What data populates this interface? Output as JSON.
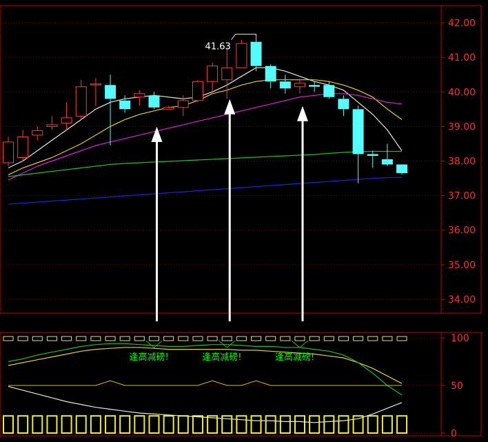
{
  "chart_data": [
    {
      "type": "candlestick",
      "ylim": [
        33.6,
        42.5
      ],
      "y_ticks": [
        "42.00",
        "41.00",
        "40.00",
        "39.00",
        "38.00",
        "37.00",
        "36.00",
        "35.00",
        "34.00"
      ],
      "peak_label": "41.63",
      "candles": [
        {
          "o": 37.95,
          "c": 38.55,
          "h": 38.7,
          "l": 37.85
        },
        {
          "o": 38.1,
          "c": 38.7,
          "h": 38.9,
          "l": 38.0
        },
        {
          "o": 38.75,
          "c": 38.88,
          "h": 39.0,
          "l": 38.6
        },
        {
          "o": 39.0,
          "c": 39.05,
          "h": 39.3,
          "l": 38.9
        },
        {
          "o": 39.1,
          "c": 39.25,
          "h": 39.7,
          "l": 38.9
        },
        {
          "o": 39.3,
          "c": 40.15,
          "h": 40.35,
          "l": 39.2
        },
        {
          "o": 40.2,
          "c": 40.23,
          "h": 40.4,
          "l": 39.6
        },
        {
          "o": 40.2,
          "c": 39.8,
          "h": 40.5,
          "l": 38.45
        },
        {
          "o": 39.75,
          "c": 39.5,
          "h": 39.9,
          "l": 39.4
        },
        {
          "o": 39.85,
          "c": 39.95,
          "h": 40.05,
          "l": 39.6
        },
        {
          "o": 39.9,
          "c": 39.55,
          "h": 40.0,
          "l": 39.5
        },
        {
          "o": 39.5,
          "c": 39.55,
          "h": 39.6,
          "l": 39.5
        },
        {
          "o": 39.55,
          "c": 39.75,
          "h": 39.9,
          "l": 39.3
        },
        {
          "o": 39.75,
          "c": 40.3,
          "h": 40.35,
          "l": 39.7
        },
        {
          "o": 40.3,
          "c": 40.75,
          "h": 40.85,
          "l": 40.0
        },
        {
          "o": 40.35,
          "c": 40.7,
          "h": 41.3,
          "l": 39.8
        },
        {
          "o": 40.7,
          "c": 41.4,
          "h": 41.5,
          "l": 40.7
        },
        {
          "o": 41.45,
          "c": 40.75,
          "h": 41.63,
          "l": 40.6
        },
        {
          "o": 40.75,
          "c": 40.3,
          "h": 40.8,
          "l": 40.1
        },
        {
          "o": 40.3,
          "c": 40.1,
          "h": 40.5,
          "l": 39.95
        },
        {
          "o": 40.15,
          "c": 40.25,
          "h": 40.35,
          "l": 39.95
        },
        {
          "o": 40.2,
          "c": 40.15,
          "h": 40.3,
          "l": 40.0
        },
        {
          "o": 40.2,
          "c": 39.85,
          "h": 40.3,
          "l": 39.8
        },
        {
          "o": 39.8,
          "c": 39.5,
          "h": 39.9,
          "l": 39.3
        },
        {
          "o": 39.5,
          "c": 38.2,
          "h": 39.6,
          "l": 37.35
        },
        {
          "o": 38.2,
          "c": 38.15,
          "h": 38.3,
          "l": 37.8
        },
        {
          "o": 38.05,
          "c": 37.9,
          "h": 38.5,
          "l": 37.85
        },
        {
          "o": 37.9,
          "c": 37.65,
          "h": 37.9,
          "l": 37.6
        }
      ],
      "ma_lines": [
        {
          "color": "#e8e8e8",
          "values": [
            37.8,
            38.0,
            38.3,
            38.6,
            38.9,
            39.2,
            39.5,
            39.7,
            39.8,
            39.85,
            39.9,
            39.85,
            39.8,
            39.85,
            40.0,
            40.2,
            40.45,
            40.7,
            40.7,
            40.6,
            40.45,
            40.3,
            40.2,
            40.05,
            39.7,
            39.35,
            38.9,
            38.3
          ]
        },
        {
          "color": "#e8d020",
          "values": [
            37.6,
            37.8,
            37.95,
            38.1,
            38.3,
            38.5,
            38.75,
            39.0,
            39.2,
            39.35,
            39.45,
            39.55,
            39.6,
            39.75,
            39.95,
            40.05,
            40.2,
            40.3,
            40.35,
            40.35,
            40.35,
            40.35,
            40.3,
            40.2,
            40.05,
            39.85,
            39.5,
            39.2
          ]
        },
        {
          "color": "#e020e0",
          "values": [
            37.45,
            37.65,
            37.85,
            38.0,
            38.15,
            38.3,
            38.45,
            38.55,
            38.65,
            38.75,
            38.85,
            38.95,
            39.05,
            39.15,
            39.25,
            39.35,
            39.45,
            39.55,
            39.65,
            39.75,
            39.85,
            39.9,
            39.95,
            39.95,
            39.9,
            39.8,
            39.7,
            39.65
          ]
        },
        {
          "color": "#20c020",
          "values": [
            37.55,
            37.6,
            37.65,
            37.7,
            37.75,
            37.8,
            37.85,
            37.9,
            37.93,
            37.95,
            37.97,
            37.99,
            38.01,
            38.03,
            38.05,
            38.07,
            38.09,
            38.11,
            38.13,
            38.15,
            38.17,
            38.19,
            38.22,
            38.25,
            38.27,
            38.28,
            38.28,
            38.28
          ]
        },
        {
          "color": "#2020e0",
          "values": [
            36.75,
            36.78,
            36.81,
            36.84,
            36.87,
            36.9,
            36.93,
            36.96,
            36.99,
            37.02,
            37.05,
            37.08,
            37.11,
            37.14,
            37.17,
            37.2,
            37.23,
            37.26,
            37.29,
            37.32,
            37.35,
            37.38,
            37.41,
            37.44,
            37.47,
            37.5,
            37.52,
            37.53
          ]
        }
      ],
      "arrow_candles": [
        10,
        15,
        20
      ]
    },
    {
      "type": "line",
      "ylim": [
        0,
        100
      ],
      "y_ticks": [
        "100",
        "50",
        "0"
      ],
      "annotation_text": "逢高减磅!",
      "annotation_candles": [
        10,
        15,
        20
      ],
      "series": [
        {
          "color": "#e8e8e8",
          "values": [
            49,
            45,
            41,
            37,
            33,
            30,
            27,
            25,
            23,
            21,
            20,
            19,
            18,
            17,
            16,
            15,
            14,
            13,
            13,
            12,
            12,
            11,
            12,
            13,
            15,
            20,
            26,
            32
          ]
        },
        {
          "color": "#e8d020",
          "values": [
            71,
            74,
            77,
            80,
            83,
            86,
            88,
            89,
            90,
            90,
            89,
            88,
            88,
            88,
            88,
            88,
            87,
            87,
            86,
            85,
            84,
            83,
            81,
            79,
            74,
            68,
            60,
            52
          ]
        },
        {
          "color": "#20c020",
          "values": [
            75,
            78,
            82,
            85,
            88,
            91,
            93,
            94,
            94,
            93,
            92,
            91,
            91,
            92,
            93,
            93,
            92,
            91,
            91,
            90,
            90,
            88,
            86,
            82,
            74,
            63,
            50,
            40
          ]
        }
      ],
      "step_line": {
        "color": "#c8c040",
        "values": [
          50,
          50,
          50,
          50,
          50,
          50,
          50,
          55,
          50,
          50,
          50,
          50,
          50,
          50,
          55,
          50,
          50,
          55,
          50,
          50,
          50,
          50,
          50,
          50,
          50,
          50,
          50,
          50
        ]
      },
      "bars": {
        "top_value": 100,
        "bottom_value": 18
      }
    }
  ]
}
